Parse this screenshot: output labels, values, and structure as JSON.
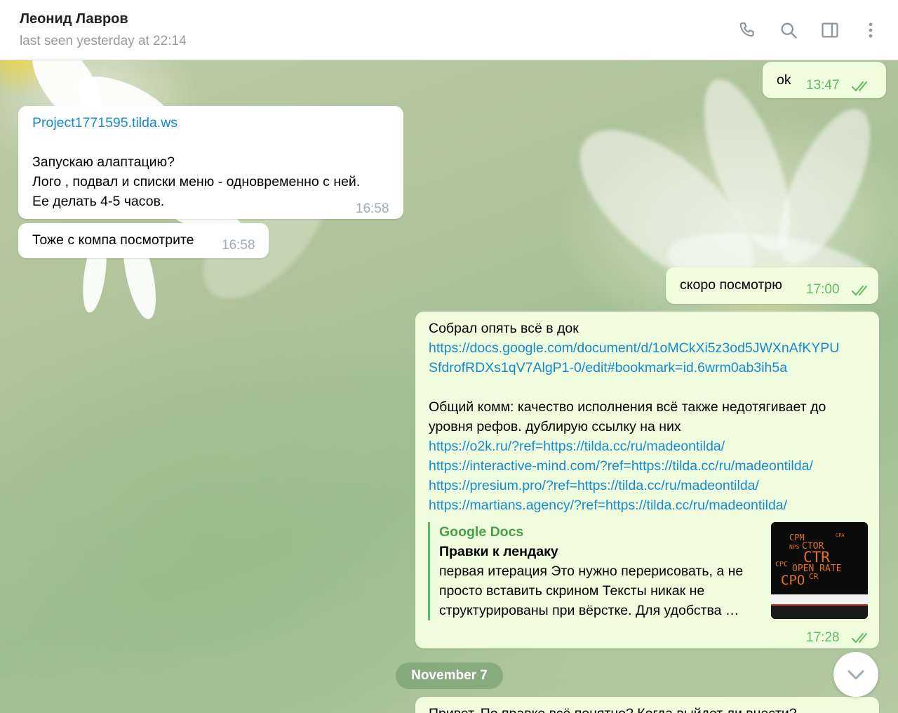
{
  "header": {
    "contact_name": "Леонид Лавров",
    "status": "last seen yesterday at 22:14",
    "icons": [
      "phone-icon",
      "search-icon",
      "sidebar-toggle-icon",
      "more-vertical-icon"
    ]
  },
  "messages": [
    {
      "direction": "out",
      "text": "ok",
      "time": "13:47",
      "read": true
    },
    {
      "direction": "in",
      "link": "Project1771595.tilda.ws",
      "lines": [
        "Запускаю алаптацию?",
        "Лого , подвал и списки меню - одновременно с ней.",
        "Ее делать 4-5 часов."
      ],
      "time": "16:58"
    },
    {
      "direction": "in",
      "text": "Тоже с компа посмотрите",
      "time": "16:58"
    },
    {
      "direction": "out",
      "text": "скоро посмотрю",
      "time": "17:00",
      "read": true
    },
    {
      "direction": "out",
      "intro": "Собрал опять всё в док",
      "doc_link_lines": [
        "https://docs.google.com/document/d/1oMCkXi5z3od5JWXnAfKYPU",
        "SfdrofRDXs1qV7AlgP1-0/edit#bookmark=id.6wrm0ab3ih5a"
      ],
      "comment_lines": [
        "Общий комм: качество исполнения всё также недотягивает до",
        "уровня рефов. дублирую ссылку на них"
      ],
      "ref_links": [
        "https://o2k.ru/?ref=https://tilda.cc/ru/madeontilda/",
        "https://interactive-mind.com/?ref=https://tilda.cc/ru/madeontilda/",
        "https://presium.pro/?ref=https://tilda.cc/ru/madeontilda/",
        "https://martians.agency/?ref=https://tilda.cc/ru/madeontilda/"
      ],
      "preview": {
        "site": "Google Docs",
        "title": "Правки к лендаку",
        "description": "первая итерация    Это нужно перерисовать, а не просто вставить скрином   Тексты никак не структурированы при вёрстке. Для удобства …",
        "thumb_words": [
          "CPM",
          "CTR",
          "OPEN RATE",
          "CPO",
          "CR",
          "CPC",
          "NPS",
          "CTOR",
          "CPA"
        ]
      },
      "time": "17:28",
      "read": true
    }
  ],
  "date_separator": "November 7",
  "partial_message": "Привет. По правке всё понятно? Когда выйдет ли внести?",
  "colors": {
    "incoming_bubble": "#ffffff",
    "outgoing_bubble": "#effdde",
    "link": "#168acd",
    "read_check": "#5fbb5f",
    "preview_accent": "#4aa049"
  }
}
